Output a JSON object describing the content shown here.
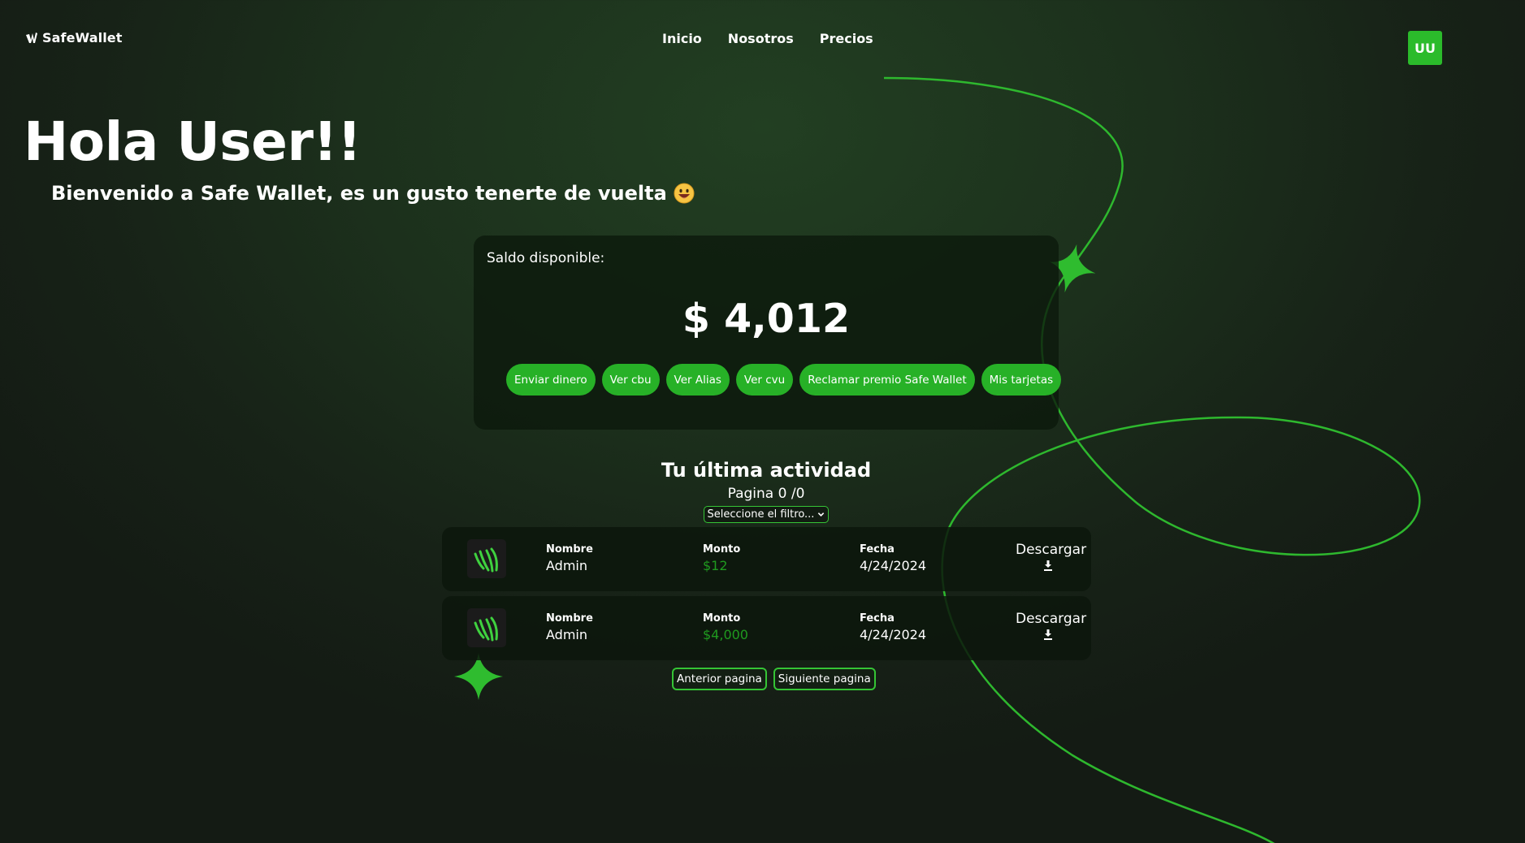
{
  "header": {
    "brand": "SafeWallet",
    "nav": [
      "Inicio",
      "Nosotros",
      "Precios"
    ],
    "avatar_initials": "UU"
  },
  "hero": {
    "greeting": "Hola User!!",
    "welcome": "Bienvenido a Safe Wallet, es un gusto tenerte de vuelta"
  },
  "balance": {
    "label": "Saldo disponible:",
    "amount": "$ 4,012",
    "actions": [
      "Enviar dinero",
      "Ver cbu",
      "Ver Alias",
      "Ver cvu",
      "Reclamar premio Safe Wallet",
      "Mis tarjetas"
    ]
  },
  "activity": {
    "title": "Tu última actividad",
    "page_info": "Pagina 0 /0",
    "filter_value": "Seleccione el filtro...",
    "transactions": [
      {
        "name_label": "Nombre",
        "name": "Admin",
        "amount_label": "Monto",
        "amount": "$12",
        "date_label": "Fecha",
        "date": "4/24/2024",
        "download_label": "Descargar"
      },
      {
        "name_label": "Nombre",
        "name": "Admin",
        "amount_label": "Monto",
        "amount": "$4,000",
        "date_label": "Fecha",
        "date": "4/24/2024",
        "download_label": "Descargar"
      }
    ],
    "prev_label": "Anterior pagina",
    "next_label": "Siguiente pagina"
  },
  "colors": {
    "accent": "#2bbb2b",
    "amount_text": "#1f9a1f",
    "background": "#1c301c"
  },
  "icons": [
    "safewallet-logo-icon",
    "grinning-emoji-icon",
    "chevron-down-icon",
    "download-icon",
    "sparkle-star-icon"
  ]
}
